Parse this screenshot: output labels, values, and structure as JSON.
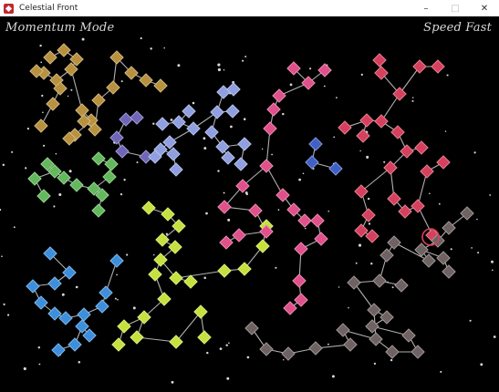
{
  "window": {
    "title": "Celestial Front",
    "minimize": "–",
    "maximize": "□",
    "close": "✕",
    "icon": "app-icon"
  },
  "hud": {
    "mode": "Momentum Mode",
    "speed": "Speed Fast"
  },
  "colors": {
    "background": "#000000",
    "gold": "#b8913f",
    "purple": "#6f66b8",
    "periwinkle": "#8f9fe0",
    "green": "#63b85c",
    "lime": "#c5e13d",
    "blue": "#3d8fdb",
    "navy": "#3f61c6",
    "pink": "#e0508a",
    "red": "#d6405c",
    "gray": "#6e6262",
    "link": "#cfcfcf",
    "star": "#d8d8d8"
  }
}
